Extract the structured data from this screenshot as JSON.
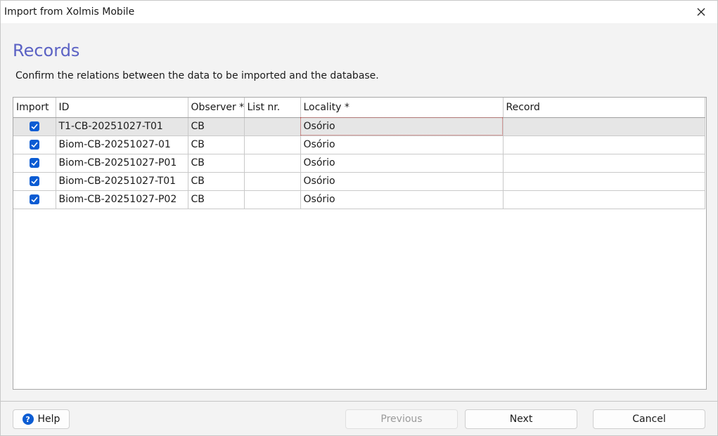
{
  "window": {
    "title": "Import from Xolmis Mobile"
  },
  "page": {
    "heading": "Records",
    "description": "Confirm the relations between the data to be imported and the database."
  },
  "grid": {
    "columns": [
      "Import",
      "ID",
      "Observer *",
      "List nr.",
      "Locality *",
      "Record"
    ],
    "rows": [
      {
        "import": true,
        "id": "T1-CB-20251027-T01",
        "observer": "CB",
        "list_nr": "",
        "locality": "Osório",
        "record": ""
      },
      {
        "import": true,
        "id": "Biom-CB-20251027-01",
        "observer": "CB",
        "list_nr": "",
        "locality": "Osório",
        "record": ""
      },
      {
        "import": true,
        "id": "Biom-CB-20251027-P01",
        "observer": "CB",
        "list_nr": "",
        "locality": "Osório",
        "record": ""
      },
      {
        "import": true,
        "id": "Biom-CB-20251027-T01",
        "observer": "CB",
        "list_nr": "",
        "locality": "Osório",
        "record": ""
      },
      {
        "import": true,
        "id": "Biom-CB-20251027-P02",
        "observer": "CB",
        "list_nr": "",
        "locality": "Osório",
        "record": ""
      }
    ]
  },
  "footer": {
    "help_label": "Help",
    "previous_label": "Previous",
    "next_label": "Next",
    "cancel_label": "Cancel"
  },
  "colors": {
    "accent": "#5b62c4",
    "checkbox": "#0b5cd3",
    "selected_row": "#e6e6e6"
  }
}
